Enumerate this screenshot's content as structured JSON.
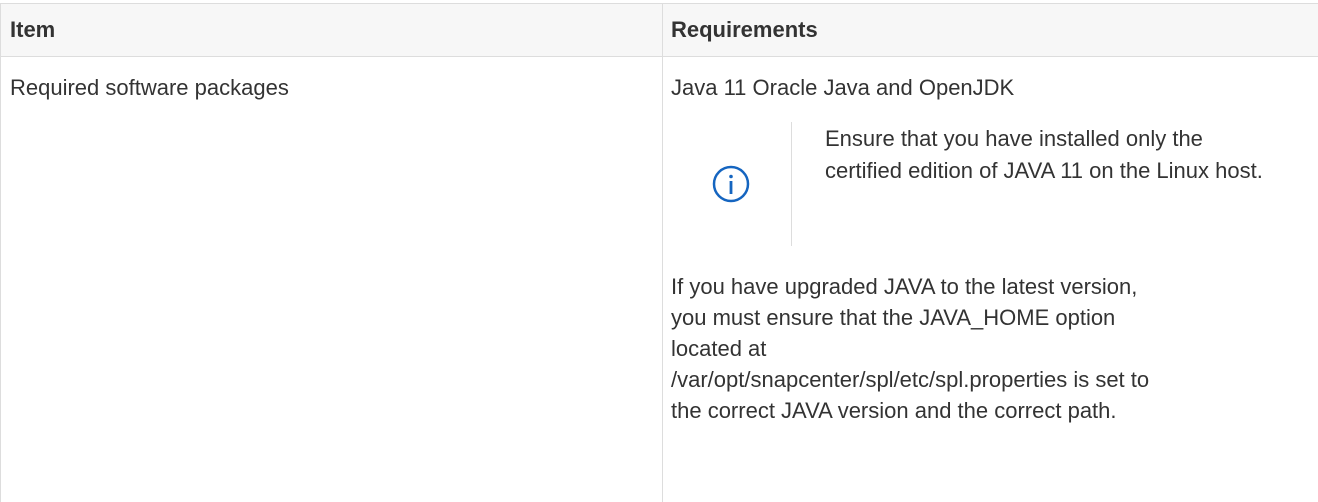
{
  "table": {
    "headers": {
      "item": "Item",
      "requirements": "Requirements"
    },
    "rows": [
      {
        "item": "Required software packages",
        "requirements": {
          "first_line": "Java 11 Oracle Java and OpenJDK",
          "note": {
            "icon": "info-icon",
            "text": "Ensure that you have installed only the certified edition of JAVA 11 on the Linux host."
          },
          "paragraph": "If you have upgraded JAVA to the latest version, you must ensure that the JAVA_HOME option located at /var/opt/snapcenter/spl/etc/spl.properties is set to the correct JAVA version and the correct path."
        }
      }
    ]
  },
  "colors": {
    "border": "#dddddd",
    "header_bg": "#f7f7f7",
    "text": "#333333",
    "icon": "#1565c0"
  }
}
